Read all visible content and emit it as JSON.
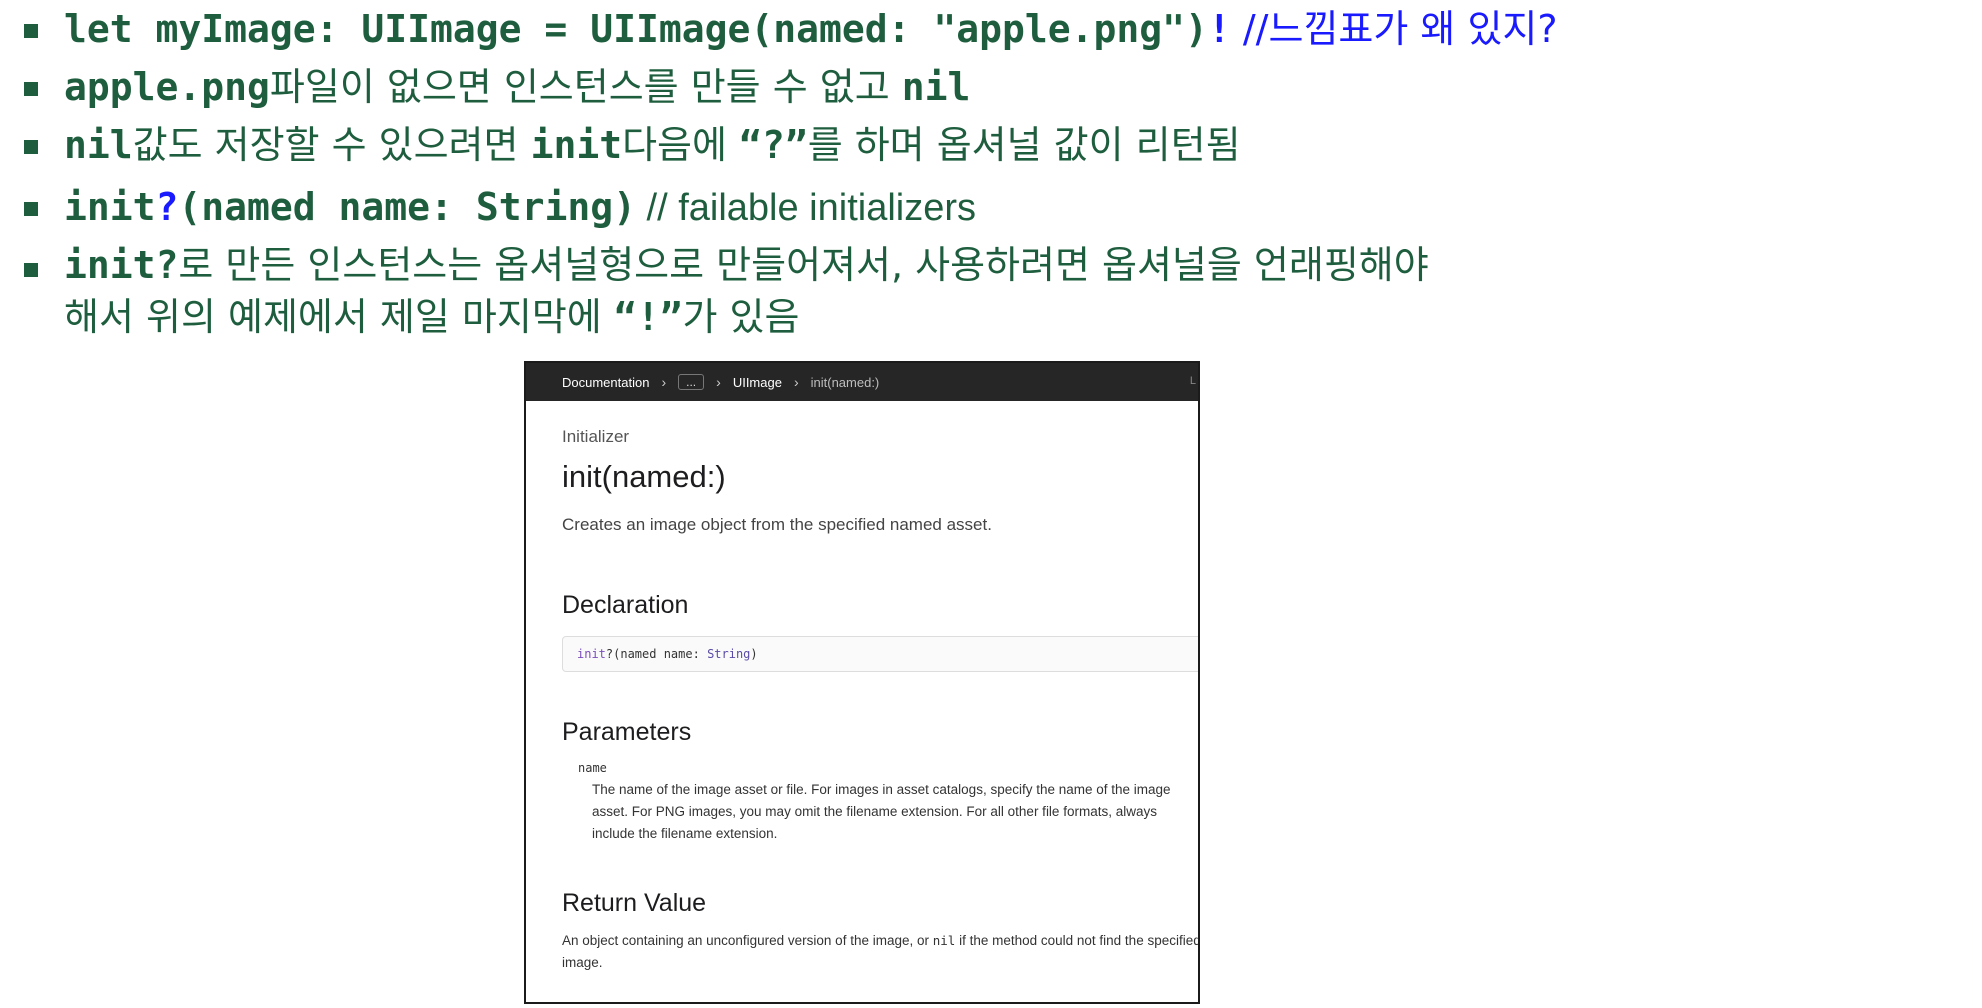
{
  "slide": {
    "bullet1": {
      "code_a": "let myImage: UIImage = UIImage(named: \"apple.png\")",
      "excl": "!",
      "comment": " //느낌표가 왜 있지?"
    },
    "bullet2": {
      "code": "apple.png",
      "text": "파일이 없으면 인스턴스를 만들 수 없고 ",
      "code_b": "nil"
    },
    "bullet3": {
      "code_a": "nil",
      "text_a": "값도 저장할 수 있으려면 ",
      "code_b": "init",
      "text_b": "다음에 ",
      "q": "“?”",
      "text_c": "를 하며 옵셔널 값이 리턴됨"
    },
    "bullet4": {
      "code_a": "init",
      "q": "?",
      "code_b": "(named name: String)",
      "comment": "  // failable initializers"
    },
    "bullet5": {
      "code": "init?",
      "text_a": "로 만든 인스턴스는 옵셔널형으로 만들어져서, 사용하려면 옵셔널을 언래핑해야",
      "text_b": "해서 위의 예제에서 제일 마지막에 ",
      "q": "“!”",
      "text_c": "가 있음"
    }
  },
  "doc": {
    "breadcrumb": [
      "Documentation",
      "...",
      "UIImage",
      "init(named:)"
    ],
    "eyebrow": "Initializer",
    "title": "init(named:)",
    "abstract": "Creates an image object from the specified named asset.",
    "declaration_heading": "Declaration",
    "declaration": {
      "kw": "init",
      "mid": "?(named name: ",
      "type": "String",
      "end": ")"
    },
    "parameters_heading": "Parameters",
    "param_name": "name",
    "param_desc": "The name of the image asset or file. For images in asset catalogs, specify the name of the image asset. For PNG images, you may omit the filename extension. For all other file formats, always include the filename extension.",
    "return_heading": "Return Value",
    "return_a": "An object containing an unconfigured version of the image, or ",
    "return_nil": "nil",
    "return_b": " if the method could not find the specified image."
  }
}
